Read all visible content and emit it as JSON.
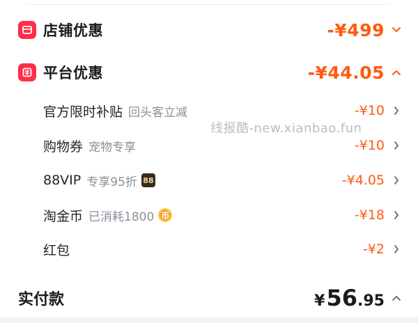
{
  "store_discount": {
    "label": "店铺优惠",
    "amount": "-¥499"
  },
  "platform_discount": {
    "label": "平台优惠",
    "amount": "-¥44.05",
    "items": [
      {
        "label": "官方限时补贴",
        "note": "回头客立减",
        "amount": "-¥10"
      },
      {
        "label": "购物券",
        "note": "宠物专享",
        "amount": "-¥10"
      },
      {
        "label": "88VIP",
        "note": "专享95折",
        "badge": "88",
        "amount": "-¥4.05"
      },
      {
        "label": "淘金币",
        "note": "已消耗1800",
        "badge": "币",
        "amount": "-¥18"
      },
      {
        "label": "红包",
        "note": "",
        "amount": "-¥2"
      }
    ]
  },
  "total": {
    "label": "实付款",
    "currency": "¥",
    "integer": "56",
    "decimal": ".95"
  },
  "watermark": "线报酷-new.xianbao.fun",
  "colors": {
    "accent": "#ff5a10",
    "brand_red": "#ff2d4a",
    "muted": "#8a8f99"
  },
  "icons": {
    "store": "store-badge-icon",
    "platform": "platform-badge-icon",
    "chevron_down": "chevron-down-icon",
    "chevron_up": "chevron-up-icon",
    "chevron_right": "chevron-right-icon"
  }
}
